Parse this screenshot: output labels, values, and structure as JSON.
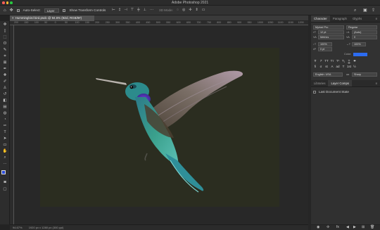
{
  "app": {
    "window_title": "Adobe Photoshop 2021"
  },
  "options_bar": {
    "auto_select_label": "Auto-Select:",
    "auto_select_value": "Layer",
    "show_transform_label": "Show Transform Controls",
    "mode_label": "3D Mode:"
  },
  "document": {
    "tab_title": "Hummingbird bird.psdc @ 94.6% (Bird, RGB/8#)",
    "canvas_color": "#2b2d20"
  },
  "status_bar": {
    "zoom": "94.67%",
    "doc_size": "1920 px x 1280 px (300 ppi)"
  },
  "rulers": {
    "top_ticks": [
      "200",
      "150",
      "100",
      "50",
      "0",
      "50",
      "100",
      "150",
      "200",
      "250",
      "300",
      "350",
      "400",
      "450",
      "500",
      "550",
      "600",
      "650",
      "700",
      "750",
      "800",
      "850",
      "900",
      "950",
      "1000",
      "1050",
      "1100",
      "1150",
      "1200"
    ]
  },
  "character_panel": {
    "tabs": [
      "Character",
      "Paragraph",
      "Glyphs"
    ],
    "font_family": "Myriad Pro",
    "font_style": "Regular",
    "font_size": "12 pt",
    "leading": "(Auto)",
    "kerning": "Metrics",
    "tracking": "0",
    "vertical_scale": "100%",
    "horizontal_scale": "100%",
    "baseline_shift": "0 pt",
    "color_label": "Color:",
    "color_value": "#2c6cf0",
    "style_buttons": [
      "T",
      "T",
      "TT",
      "Tт",
      "T¹",
      "T₁",
      "T",
      "T"
    ],
    "opentype_buttons": [
      "fi",
      "σ",
      "st",
      "A",
      "ad",
      "T",
      "1st",
      "½"
    ],
    "language": "English: USA",
    "antialias_label": "aa",
    "antialias": "Sharp"
  },
  "lower_panel": {
    "tabs": [
      "Libraries",
      "Layer Comps"
    ],
    "row_label": "Last Document State"
  }
}
